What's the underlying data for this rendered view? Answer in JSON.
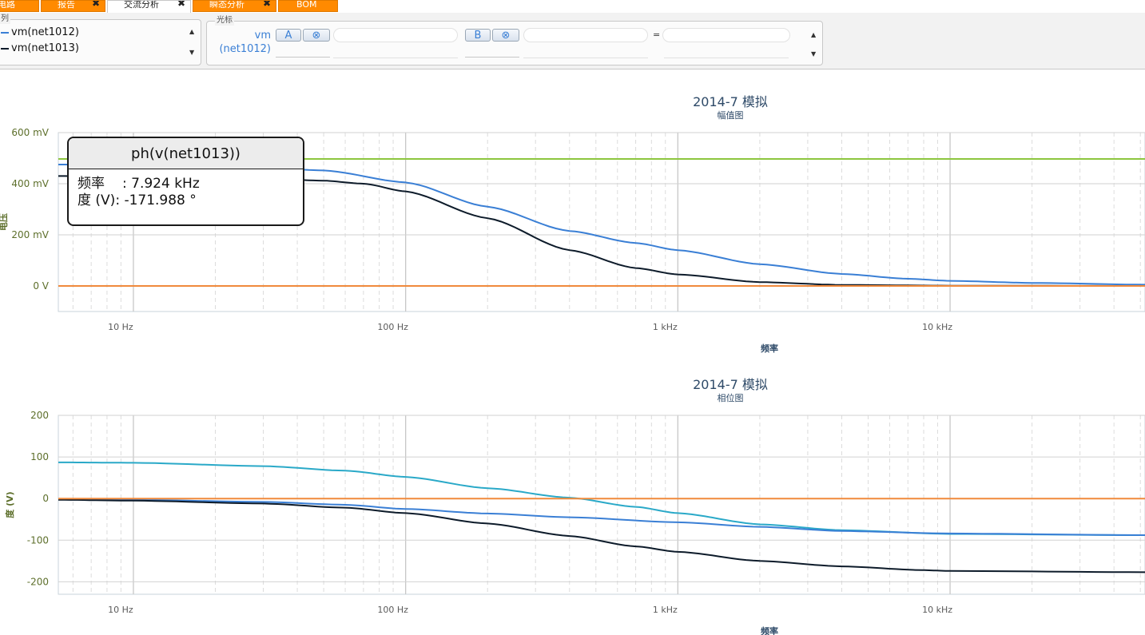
{
  "tabs": [
    {
      "label": "电路",
      "active": false,
      "closable": false
    },
    {
      "label": "报告",
      "active": false,
      "closable": true
    },
    {
      "label": "交流分析",
      "active": true,
      "closable": true
    },
    {
      "label": "瞬态分析",
      "active": false,
      "closable": true
    },
    {
      "label": "BOM",
      "active": false,
      "closable": false
    }
  ],
  "series_panel": {
    "legend": "列",
    "items": [
      {
        "label": "vm(net1012)",
        "color": "#3a7fd5"
      },
      {
        "label": "vm(net1013)",
        "color": "#0d1b2a"
      }
    ]
  },
  "cursor_panel": {
    "legend": "光标",
    "row_label_1": "vm",
    "row_label_2": "(net1012)",
    "btn_a": "A",
    "btn_a_clear": "⊗",
    "btn_b": "B",
    "btn_b_clear": "⊗",
    "equals": "="
  },
  "tooltip": {
    "title": "ph(v(net1013))",
    "freq_label": "频率",
    "freq_value": ": 7.924 kHz",
    "deg_label": "度 (V)",
    "deg_value": ": -171.988 °"
  },
  "chart_data": [
    {
      "type": "line",
      "title": "2014-7 模拟",
      "subtitle": "幅值图",
      "xlabel": "频率",
      "ylabel": "电压",
      "x_scale": "log",
      "x_tick_labels": [
        "10 Hz",
        "100 Hz",
        "1 kHz",
        "10 kHz"
      ],
      "y_tick_labels": [
        "600 mV",
        "400 mV",
        "200 mV",
        "0 V"
      ],
      "y_ticks": [
        600,
        400,
        200,
        0
      ],
      "ylim": [
        -100,
        600
      ],
      "xlim": [
        5.3,
        52000
      ],
      "grid": true,
      "series": [
        {
          "name": "vm(net1012)",
          "color": "#3a7fd5",
          "x": [
            5.3,
            10,
            30,
            50,
            100,
            200,
            400,
            700,
            1000,
            2000,
            4000,
            7000,
            10000,
            20000,
            52000
          ],
          "y": [
            475,
            472,
            462,
            452,
            405,
            310,
            215,
            168,
            140,
            85,
            47,
            28,
            20,
            12,
            5
          ]
        },
        {
          "name": "vm(net1013)",
          "color": "#0d1b2a",
          "x": [
            5.3,
            10,
            30,
            50,
            70,
            100,
            200,
            400,
            700,
            1000,
            2000,
            4000,
            10000,
            52000
          ],
          "y": [
            430,
            428,
            420,
            412,
            400,
            370,
            265,
            140,
            70,
            45,
            15,
            4,
            1,
            0
          ]
        },
        {
          "color": "#8dc63f",
          "x": [
            5.3,
            52000
          ],
          "y": [
            497,
            497
          ]
        },
        {
          "color": "#f08a3c",
          "x": [
            5.3,
            52000
          ],
          "y": [
            0,
            0
          ]
        }
      ]
    },
    {
      "type": "line",
      "title": "2014-7 模拟",
      "subtitle": "相位图",
      "xlabel": "频率",
      "ylabel": "度 (V)",
      "x_scale": "log",
      "x_tick_labels": [
        "10 Hz",
        "100 Hz",
        "1 kHz",
        "10 kHz"
      ],
      "y_tick_labels": [
        "200",
        "100",
        "0",
        "-100",
        "-200"
      ],
      "y_ticks": [
        200,
        100,
        0,
        -100,
        -200
      ],
      "ylim": [
        -230,
        200
      ],
      "xlim": [
        5.3,
        52000
      ],
      "grid": true,
      "series": [
        {
          "color": "#2aa9c8",
          "x": [
            5.3,
            10,
            30,
            60,
            100,
            200,
            400,
            700,
            1000,
            2000,
            4000,
            10000,
            52000
          ],
          "y": [
            87,
            86,
            78,
            67,
            52,
            25,
            2,
            -20,
            -35,
            -62,
            -76,
            -85,
            -88
          ]
        },
        {
          "name": "vm(net1012)",
          "color": "#3a7fd5",
          "x": [
            5.3,
            10,
            30,
            60,
            100,
            200,
            400,
            1000,
            2000,
            4000,
            10000,
            52000
          ],
          "y": [
            -2,
            -3,
            -8,
            -15,
            -25,
            -36,
            -45,
            -57,
            -68,
            -78,
            -84,
            -88
          ]
        },
        {
          "name": "vm(net1013)",
          "color": "#0d1b2a",
          "x": [
            5.3,
            10,
            30,
            60,
            100,
            200,
            400,
            700,
            1000,
            2000,
            4000,
            7900,
            10000,
            52000
          ],
          "y": [
            -3,
            -5,
            -12,
            -22,
            -35,
            -60,
            -90,
            -115,
            -128,
            -150,
            -163,
            -172,
            -174,
            -177
          ]
        },
        {
          "color": "#f08a3c",
          "x": [
            5.3,
            52000
          ],
          "y": [
            0,
            0
          ]
        }
      ]
    }
  ]
}
